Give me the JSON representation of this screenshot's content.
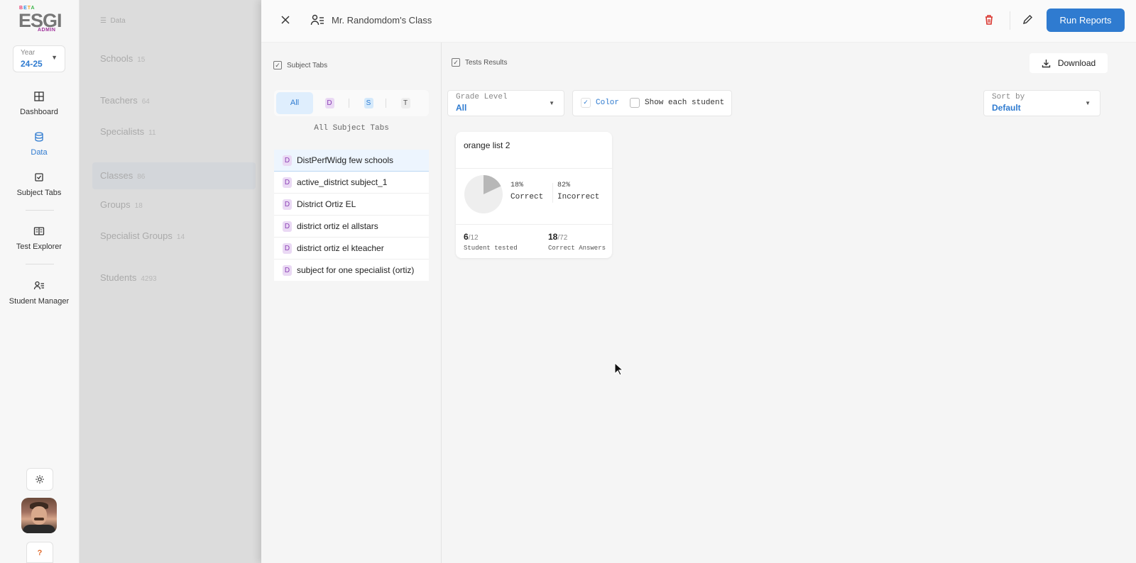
{
  "sidebar": {
    "logo": {
      "beta": "BETA",
      "brand": "ESGI",
      "tag": "ADMIN"
    },
    "year": {
      "label": "Year",
      "value": "24-25"
    },
    "items": [
      {
        "label": "Dashboard",
        "icon": "grid-icon"
      },
      {
        "label": "Data",
        "icon": "database-icon",
        "active": true
      },
      {
        "label": "Subject Tabs",
        "icon": "checkbox-icon"
      },
      {
        "label": "Test Explorer",
        "icon": "book-icon"
      },
      {
        "label": "Student Manager",
        "icon": "user-list-icon"
      }
    ],
    "help": "?"
  },
  "background_list": {
    "header": "Data",
    "rows": [
      {
        "label": "Schools",
        "count": "15"
      },
      {
        "label": "Teachers",
        "count": "64"
      },
      {
        "label": "Specialists",
        "count": "11"
      },
      {
        "label": "Classes",
        "count": "86"
      },
      {
        "label": "Groups",
        "count": "18"
      },
      {
        "label": "Specialist Groups",
        "count": "14"
      },
      {
        "label": "Students",
        "count": "4293"
      }
    ]
  },
  "panel": {
    "title": "Mr. Randomdom's Class",
    "run_reports": "Run Reports",
    "subject_tabs": {
      "title": "Subject Tabs",
      "filters": {
        "all": "All",
        "d": "D",
        "s": "S",
        "t": "T"
      },
      "caption": "All Subject Tabs",
      "items": [
        {
          "type": "D",
          "label": "DistPerfWidg few schools",
          "selected": true
        },
        {
          "type": "D",
          "label": "active_district subject_1"
        },
        {
          "type": "D",
          "label": "District Ortiz EL"
        },
        {
          "type": "D",
          "label": "district ortiz el allstars"
        },
        {
          "type": "D",
          "label": "district ortiz el kteacher"
        },
        {
          "type": "D",
          "label": "subject for one specialist (ortiz)"
        }
      ]
    },
    "results": {
      "title": "Tests Results",
      "download": "Download",
      "grade_level": {
        "label": "Grade Level",
        "value": "All"
      },
      "color": {
        "label": "Color",
        "checked": true
      },
      "show_each": {
        "label": "Show each student",
        "checked": false
      },
      "sort_by": {
        "label": "Sort by",
        "value": "Default"
      },
      "card": {
        "title": "orange list 2",
        "correct_pct": "18%",
        "correct_label": "Correct",
        "incorrect_pct": "82%",
        "incorrect_label": "Incorrect",
        "correct_fraction": 0.18,
        "tested": "6",
        "tested_total": "/12",
        "tested_label": "Student tested",
        "answers": "18",
        "answers_total": "/72",
        "answers_label": "Correct Answers"
      }
    }
  },
  "colors": {
    "accent": "#2f7bd0",
    "danger": "#d9322b",
    "district": "#8a3fb5"
  }
}
